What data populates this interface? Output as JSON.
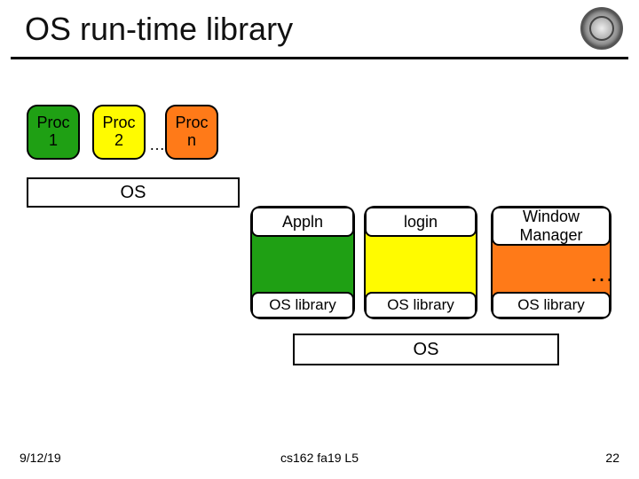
{
  "title": "OS run-time library",
  "procs": {
    "p1": "Proc\n1",
    "p2": "Proc\n2",
    "ellipsis": "…",
    "pn": "Proc\nn"
  },
  "os_small": "OS",
  "columns": {
    "c1_head": "Appln",
    "c1_foot": "OS library",
    "c2_head": "login",
    "c2_foot": "OS library",
    "c3_head": "Window\nManager",
    "c3_foot": "OS library",
    "ellipsis": "…"
  },
  "os_big": "OS",
  "footer": {
    "date": "9/12/19",
    "center": "cs162 fa19 L5",
    "page": "22"
  }
}
